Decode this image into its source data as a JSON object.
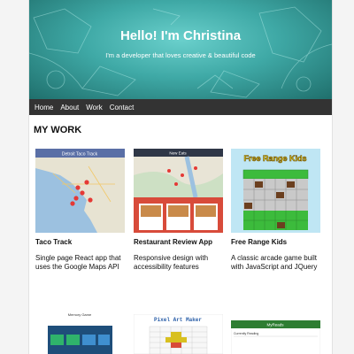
{
  "hero": {
    "title": "Hello! I'm Christina",
    "subtitle": "I'm a developer that loves creative & beautiful code"
  },
  "nav": {
    "items": [
      "Home",
      "About",
      "Work",
      "Contact"
    ]
  },
  "work": {
    "heading": "MY WORK",
    "projects": [
      {
        "title": "Taco Track",
        "description_lines": [
          "Single page React app that",
          "uses the Google Maps API"
        ],
        "thumb_heading": "Detroit Taco Track"
      },
      {
        "title": "Restaurant Review App",
        "description_lines": [
          "Responsive design with",
          "accessibility features"
        ],
        "thumb_heading": "New Eats"
      },
      {
        "title": "Free Range Kids",
        "description_lines": [
          "A classic arcade game built",
          "with JavaScript and JQuery"
        ],
        "thumb_heading": "Free Range Kids"
      }
    ],
    "more_thumbs": [
      {
        "heading": "Memory Game"
      },
      {
        "heading": "Pixel Art Maker"
      },
      {
        "heading": "MyReads",
        "subheading": "Currently Reading"
      }
    ]
  },
  "colors": {
    "hero_teal": "#3fa9a6",
    "nav_bg": "#333333",
    "taco_header": "#5a6fa6",
    "map_sea": "#9cc1e0",
    "map_land": "#e7e3d2",
    "review_header": "#2f3747",
    "review_red": "#d84b3a",
    "arcade_grass": "#3cbb3c",
    "arcade_sky": "#bfe6f4",
    "arcade_title": "#f5e21c",
    "memory_tile": "#2a6495",
    "myreads_green": "#2e7d32"
  }
}
